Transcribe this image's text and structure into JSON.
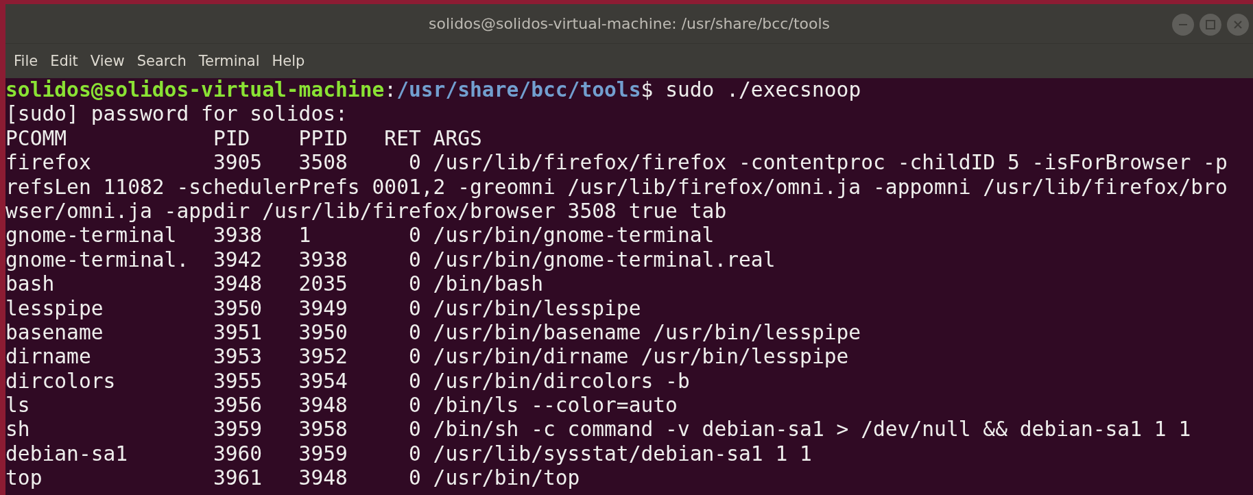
{
  "window": {
    "title": "solidos@solidos-virtual-machine: /usr/share/bcc/tools"
  },
  "window_buttons": [
    {
      "kind": "minimize"
    },
    {
      "kind": "maximize"
    },
    {
      "kind": "close"
    }
  ],
  "menu": [
    "File",
    "Edit",
    "View",
    "Search",
    "Terminal",
    "Help"
  ],
  "terminal": {
    "lines": [
      {
        "kind": "prompt",
        "user": "solidos@solidos-virtual-machine",
        "separator": ":",
        "path": "/usr/share/bcc/tools",
        "command": "$ sudo ./execsnoop"
      },
      {
        "kind": "output",
        "text": "[sudo] password for solidos:"
      },
      {
        "kind": "output",
        "text": "PCOMM            PID    PPID   RET ARGS"
      },
      {
        "kind": "output",
        "text": "firefox          3905   3508     0 /usr/lib/firefox/firefox -contentproc -childID 5 -isForBrowser -p"
      },
      {
        "kind": "output",
        "text": "refsLen 11082 -schedulerPrefs 0001,2 -greomni /usr/lib/firefox/omni.ja -appomni /usr/lib/firefox/bro"
      },
      {
        "kind": "output",
        "text": "wser/omni.ja -appdir /usr/lib/firefox/browser 3508 true tab"
      },
      {
        "kind": "output",
        "text": "gnome-terminal   3938   1        0 /usr/bin/gnome-terminal"
      },
      {
        "kind": "output",
        "text": "gnome-terminal.  3942   3938     0 /usr/bin/gnome-terminal.real"
      },
      {
        "kind": "output",
        "text": "bash             3948   2035     0 /bin/bash"
      },
      {
        "kind": "output",
        "text": "lesspipe         3950   3949     0 /usr/bin/lesspipe"
      },
      {
        "kind": "output",
        "text": "basename         3951   3950     0 /usr/bin/basename /usr/bin/lesspipe"
      },
      {
        "kind": "output",
        "text": "dirname          3953   3952     0 /usr/bin/dirname /usr/bin/lesspipe"
      },
      {
        "kind": "output",
        "text": "dircolors        3955   3954     0 /usr/bin/dircolors -b"
      },
      {
        "kind": "output",
        "text": "ls               3956   3948     0 /bin/ls --color=auto"
      },
      {
        "kind": "output",
        "text": "sh               3959   3958     0 /bin/sh -c command -v debian-sa1 > /dev/null && debian-sa1 1 1"
      },
      {
        "kind": "output",
        "text": "debian-sa1       3960   3959     0 /usr/lib/sysstat/debian-sa1 1 1"
      },
      {
        "kind": "output",
        "text": "top              3961   3948     0 /usr/bin/top"
      }
    ]
  }
}
